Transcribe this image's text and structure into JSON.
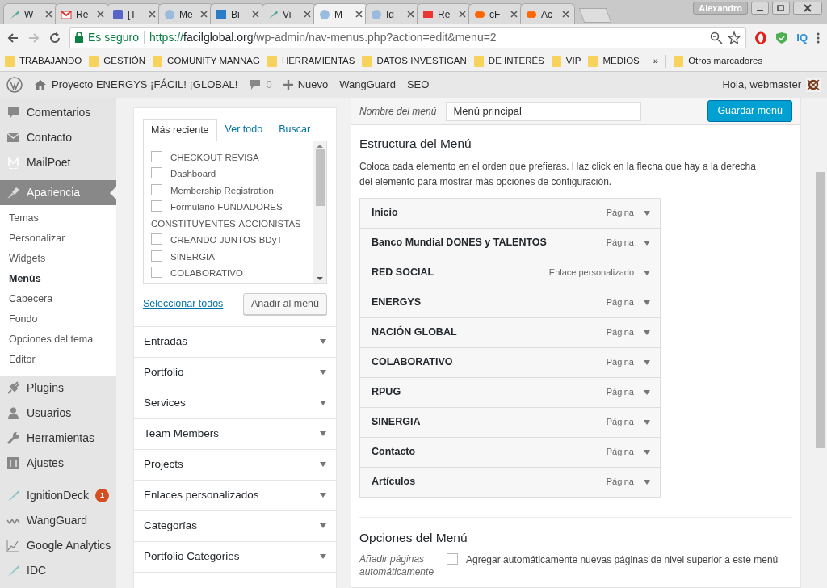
{
  "browser": {
    "tabs": [
      {
        "title": "W",
        "selected": false
      },
      {
        "title": "Re",
        "selected": false
      },
      {
        "title": "[T",
        "selected": false
      },
      {
        "title": "Me",
        "selected": false
      },
      {
        "title": "Bi",
        "selected": false
      },
      {
        "title": "Vi",
        "selected": false
      },
      {
        "title": "M",
        "selected": true
      },
      {
        "title": "Id",
        "selected": false
      },
      {
        "title": "Re",
        "selected": false
      },
      {
        "title": "cF",
        "selected": false
      },
      {
        "title": "Ac",
        "selected": false
      }
    ],
    "profile": "Alexandro",
    "security_label": "Es seguro",
    "url_scheme": "https://",
    "url_host": "facilglobal.org",
    "url_path": "/wp-admin/nav-menus.php?action=edit&menu=2",
    "extension_label": "IQ",
    "bookmarks": [
      "TRABAJANDO",
      "GESTIÓN",
      "COMUNITY MANNAG",
      "HERRAMIENTAS",
      "DATOS INVESTIGAN",
      "DE INTERÉS",
      "VIP",
      "MEDIOS"
    ],
    "bookmarks_overflow": "»",
    "other_bookmarks": "Otros marcadores"
  },
  "admin_bar": {
    "site": "Proyecto ENERGYS ¡FÁCIL! ¡GLOBAL!",
    "comments": "0",
    "new": "Nuevo",
    "items": [
      "WangGuard",
      "SEO"
    ],
    "greeting": "Hola, webmaster"
  },
  "sidebar": {
    "sections": [
      [
        {
          "label": "Comentarios",
          "selected": false
        },
        {
          "label": "Contacto",
          "selected": false
        },
        {
          "label": "MailPoet",
          "selected": false
        },
        {
          "label": "Apariencia",
          "selected": true,
          "children": [
            {
              "label": "Temas",
              "selected": false
            },
            {
              "label": "Personalizar",
              "selected": false
            },
            {
              "label": "Widgets",
              "selected": false
            },
            {
              "label": "Menús",
              "selected": true
            },
            {
              "label": "Cabecera",
              "selected": false
            },
            {
              "label": "Fondo",
              "selected": false
            },
            {
              "label": "Opciones del tema",
              "selected": false
            },
            {
              "label": "Editor",
              "selected": false
            }
          ]
        },
        {
          "label": "Plugins",
          "selected": false
        },
        {
          "label": "Usuarios",
          "selected": false
        },
        {
          "label": "Herramientas",
          "selected": false
        },
        {
          "label": "Ajustes",
          "selected": false
        }
      ],
      [
        {
          "label": "IgnitionDeck",
          "selected": false,
          "badge": "1"
        },
        {
          "label": "WangGuard",
          "selected": false
        },
        {
          "label": "Google Analytics",
          "selected": false
        },
        {
          "label": "IDC",
          "selected": false
        }
      ]
    ]
  },
  "pages_box": {
    "tabs": [
      {
        "label": "Más reciente",
        "selected": true
      },
      {
        "label": "Ver todo",
        "selected": false
      },
      {
        "label": "Buscar",
        "selected": false
      }
    ],
    "items": [
      {
        "label": "CHECKOUT REVISA",
        "checked": false
      },
      {
        "label": "Dashboard",
        "checked": false
      },
      {
        "label": "Membership Registration",
        "checked": false
      },
      {
        "label": "Formulario FUNDADORES-CONSTITUYENTES-ACCIONISTAS",
        "checked": false
      },
      {
        "label": "CREANDO JUNTOS BDyT",
        "checked": false
      },
      {
        "label": "SINERGIA",
        "checked": false
      },
      {
        "label": "COLABORATIVO",
        "checked": false
      }
    ],
    "select_all": "Seleccionar todos",
    "add_button": "Añadir al menú"
  },
  "sections": [
    {
      "title": "Entradas",
      "expanded": false
    },
    {
      "title": "Portfolio",
      "expanded": false
    },
    {
      "title": "Services",
      "expanded": false
    },
    {
      "title": "Team Members",
      "expanded": false
    },
    {
      "title": "Projects",
      "expanded": false
    },
    {
      "title": "Enlaces personalizados",
      "expanded": false
    },
    {
      "title": "Categorías",
      "expanded": false
    },
    {
      "title": "Portfolio Categories",
      "expanded": false
    }
  ],
  "menu_name": {
    "label": "Nombre del menú",
    "value": "Menú principal"
  },
  "save_button": "Guardar menú",
  "structure": {
    "title": "Estructura del Menú",
    "description": "Coloca cada elemento en el orden que prefieras. Haz click en la flecha que hay a la derecha del elemento para mostrar más opciones de configuración.",
    "items": [
      {
        "title": "Inicio",
        "type": "Página"
      },
      {
        "title": "Banco Mundial DONES y TALENTOS",
        "type": "Página"
      },
      {
        "title": "RED SOCIAL",
        "type": "Enlace personalizado"
      },
      {
        "title": "ENERGYS",
        "type": "Página"
      },
      {
        "title": "NACIÓN GLOBAL",
        "type": "Página"
      },
      {
        "title": "COLABORATIVO",
        "type": "Página"
      },
      {
        "title": "RPUG",
        "type": "Página"
      },
      {
        "title": "SINERGIA",
        "type": "Página"
      },
      {
        "title": "Contacto",
        "type": "Página"
      },
      {
        "title": "Artículos",
        "type": "Página"
      }
    ]
  },
  "options": {
    "title": "Opciones del Menú",
    "field_label": "Añadir páginas automáticamente",
    "auto_add": {
      "label": "Agregar automáticamente nuevas páginas de nivel superior a este menú",
      "checked": false
    }
  }
}
